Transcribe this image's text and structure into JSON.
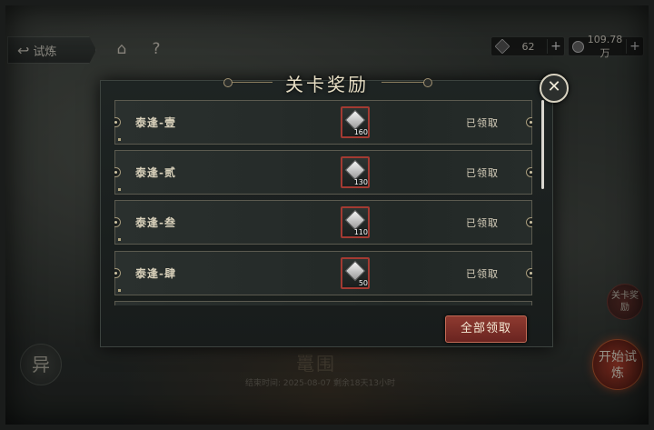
{
  "topbar": {
    "back_label": "试炼",
    "back_icon": "back-arrow-icon",
    "home_icon": "home-icon",
    "help_label": "?",
    "gem_amount": "62",
    "coin_amount": "109.78万",
    "plus": "+"
  },
  "modal": {
    "title": "关卡奖励",
    "close": "✕",
    "rows": [
      {
        "name": "泰逢-壹",
        "qty": "160",
        "status": "已领取"
      },
      {
        "name": "泰逢-贰",
        "qty": "130",
        "status": "已领取"
      },
      {
        "name": "泰逢-叁",
        "qty": "110",
        "status": "已领取"
      },
      {
        "name": "泰逢-肆",
        "qty": "50",
        "status": "已领取"
      }
    ],
    "claim_all_label": "全部领取"
  },
  "background": {
    "stage_name": "鼍围",
    "end_time": "结束时间: 2025-08-07  剩余18天13小时",
    "yi_label": "异",
    "reward_label": "关卡奖励",
    "start_label": "开始试炼"
  },
  "colors": {
    "accent_red": "#8e3a30",
    "item_border": "#a33a32",
    "gold_line": "#8a7d5e"
  }
}
